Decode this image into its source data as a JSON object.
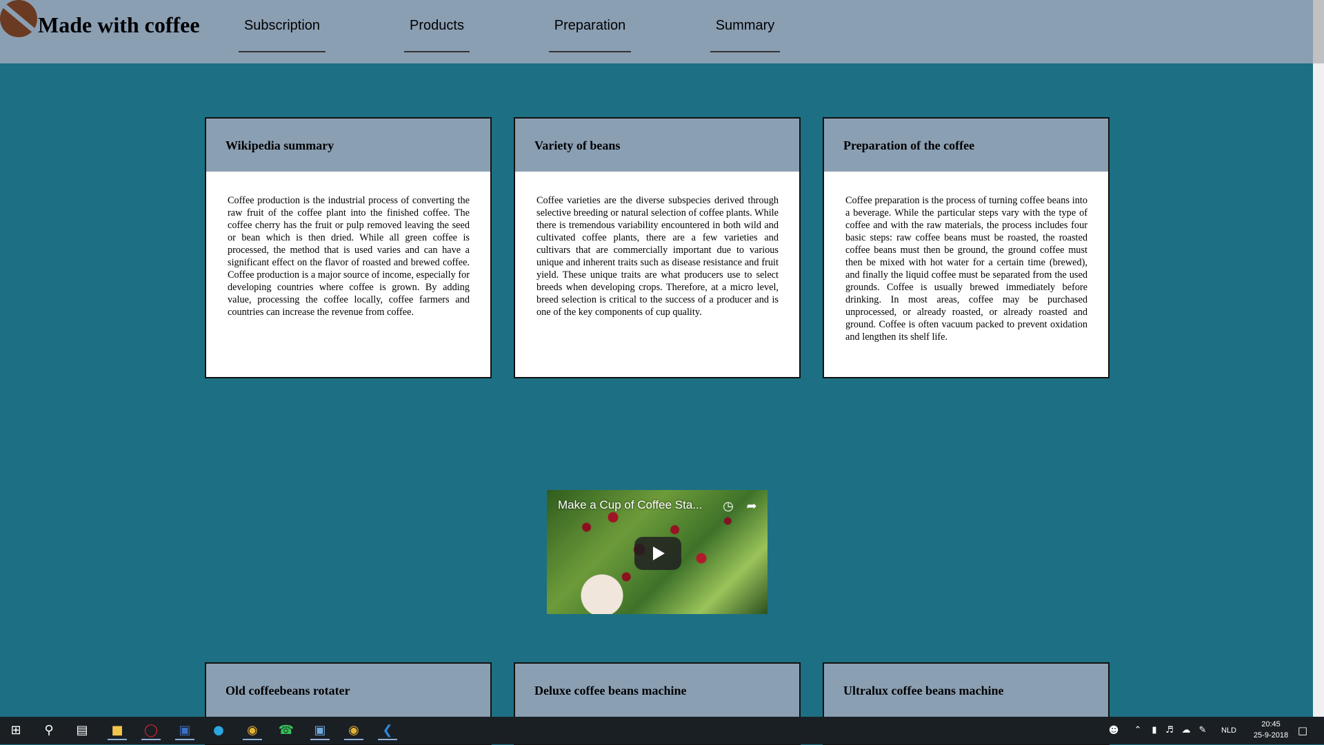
{
  "header": {
    "site_title": "Made with coffee",
    "nav": [
      "Subscription",
      "Products",
      "Preparation",
      "Summary"
    ]
  },
  "cards": [
    {
      "title": "Wikipedia summary",
      "body": "Coffee production is the industrial process of converting the raw fruit of the coffee plant into the finished coffee. The coffee cherry has the fruit or pulp removed leaving the seed or bean which is then dried. While all green coffee is processed, the method that is used varies and can have a significant effect on the flavor of roasted and brewed coffee. Coffee production is a major source of income, especially for developing countries where coffee is grown. By adding value, processing the coffee locally, coffee farmers and countries can increase the revenue from coffee."
    },
    {
      "title": "Variety of beans",
      "body": "Coffee varieties are the diverse subspecies derived through selective breeding or natural selection of coffee plants. While there is tremendous variability encountered in both wild and cultivated coffee plants, there are a few varieties and cultivars that are commercially important due to various unique and inherent traits such as disease resistance and fruit yield. These unique traits are what producers use to select breeds when developing crops. Therefore, at a micro level, breed selection is critical to the success of a producer and is one of the key components of cup quality."
    },
    {
      "title": "Preparation of the coffee",
      "body": "Coffee preparation is the process of turning coffee beans into a beverage. While the particular steps vary with the type of coffee and with the raw materials, the process includes four basic steps: raw coffee beans must be roasted, the roasted coffee beans must then be ground, the ground coffee must then be mixed with hot water for a certain time (brewed), and finally the liquid coffee must be separated from the used grounds. Coffee is usually brewed immediately before drinking. In most areas, coffee may be purchased unprocessed, or already roasted, or already roasted and ground. Coffee is often vacuum packed to prevent oxidation and lengthen its shelf life."
    }
  ],
  "video": {
    "title": "Make a Cup of Coffee Sta..."
  },
  "product_cards": [
    {
      "title": "Old coffeebeans rotater"
    },
    {
      "title": "Deluxe coffee beans machine"
    },
    {
      "title": "Ultralux coffee beans machine"
    }
  ],
  "taskbar": {
    "language": "NLD",
    "time": "20:45",
    "date": "25-9-2018",
    "apps": [
      "start-icon",
      "search-icon",
      "task-view-icon",
      "file-explorer-icon",
      "opera-icon",
      "word-icon",
      "skype-icon",
      "chrome-icon",
      "whatsapp-icon",
      "app-icon",
      "chrome-icon",
      "vscode-icon"
    ]
  },
  "colors": {
    "page_background": "#1d7083",
    "header_background": "#8b9fb3",
    "card_background": "#ffffff",
    "taskbar_background": "#1a1f24"
  }
}
